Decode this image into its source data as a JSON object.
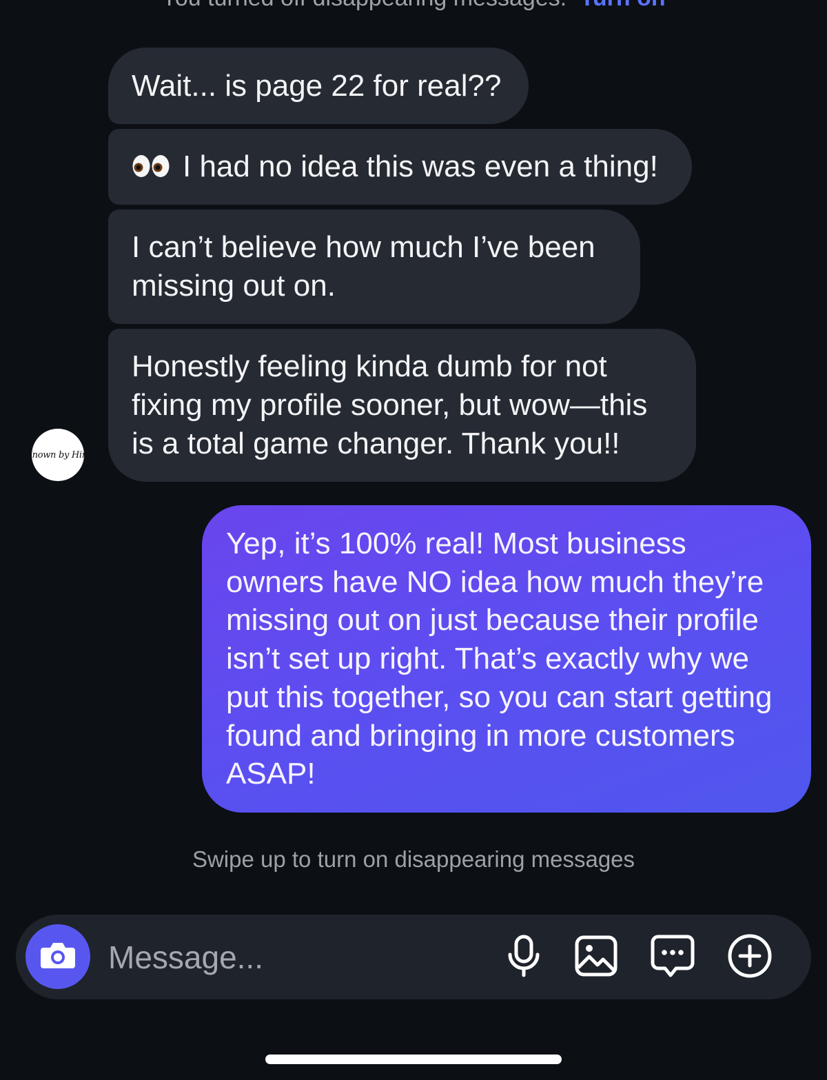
{
  "header": {
    "notice_text": "You turned off disappearing messages.",
    "notice_link": "Turn on"
  },
  "thread": {
    "contact_avatar_text": "Known by Him",
    "incoming": [
      "Wait... is page 22 for real??",
      "I had no idea this was even a thing!",
      "I can’t believe how much I’ve been missing out on.",
      "Honestly feeling kinda dumb for not fixing my profile sooner, but wow—this is a total game changer. Thank you!!"
    ],
    "incoming_emoji_icon": "eyes-emoji",
    "outgoing": "Yep, it’s 100% real! Most business owners have NO idea how much they’re missing out on just because their profile isn’t set up right. That’s exactly why we put this together, so you can start getting found and bringing in more customers ASAP!"
  },
  "footer_hint": "Swipe up to turn on disappearing messages",
  "composer": {
    "placeholder": "Message...",
    "icons": [
      "camera-icon",
      "microphone-icon",
      "image-icon",
      "sticker-icon",
      "plus-icon"
    ]
  },
  "colors": {
    "background": "#0c0f14",
    "incoming_bubble": "#262a33",
    "outgoing_bubble": "#5a4ff0",
    "accent": "#5757f0",
    "link": "#5b73ff"
  }
}
